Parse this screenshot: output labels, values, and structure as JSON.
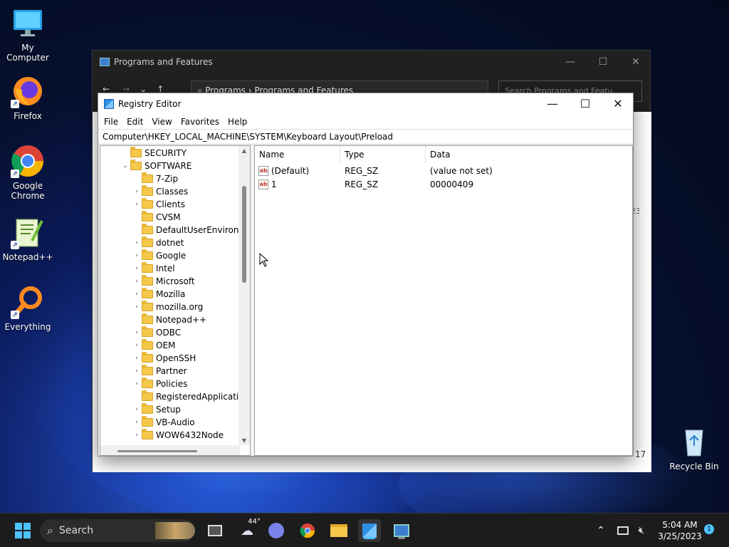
{
  "desktop": {
    "icons": [
      {
        "label": "My Computer",
        "icon": "monitor-icon"
      },
      {
        "label": "Firefox",
        "icon": "firefox-icon"
      },
      {
        "label": "Google Chrome",
        "icon": "chrome-icon"
      },
      {
        "label": "Notepad++",
        "icon": "notepadpp-icon"
      },
      {
        "label": "Everything",
        "icon": "everything-icon"
      },
      {
        "label": "Recycle Bin",
        "icon": "recycle-bin-icon"
      }
    ]
  },
  "programs_window": {
    "title": "Programs and Features",
    "breadcrumb": [
      "Programs",
      "Programs and Features"
    ],
    "search_placeholder": "Search Programs and Featu...",
    "side_marks": "23",
    "bottom_count": "17"
  },
  "registry": {
    "title": "Registry Editor",
    "menu": [
      "File",
      "Edit",
      "View",
      "Favorites",
      "Help"
    ],
    "address": "Computer\\HKEY_LOCAL_MACHINE\\SYSTEM\\Keyboard Layout\\Preload",
    "tree": [
      {
        "label": "SECURITY",
        "level": 1,
        "chevron": ""
      },
      {
        "label": "SOFTWARE",
        "level": 1,
        "chevron": "expanded"
      },
      {
        "label": "7-Zip",
        "level": 2,
        "chevron": ""
      },
      {
        "label": "Classes",
        "level": 2,
        "chevron": "collapsed"
      },
      {
        "label": "Clients",
        "level": 2,
        "chevron": "collapsed"
      },
      {
        "label": "CVSM",
        "level": 2,
        "chevron": ""
      },
      {
        "label": "DefaultUserEnvironm",
        "level": 2,
        "chevron": ""
      },
      {
        "label": "dotnet",
        "level": 2,
        "chevron": "collapsed"
      },
      {
        "label": "Google",
        "level": 2,
        "chevron": "collapsed"
      },
      {
        "label": "Intel",
        "level": 2,
        "chevron": "collapsed"
      },
      {
        "label": "Microsoft",
        "level": 2,
        "chevron": "collapsed"
      },
      {
        "label": "Mozilla",
        "level": 2,
        "chevron": "collapsed"
      },
      {
        "label": "mozilla.org",
        "level": 2,
        "chevron": "collapsed"
      },
      {
        "label": "Notepad++",
        "level": 2,
        "chevron": ""
      },
      {
        "label": "ODBC",
        "level": 2,
        "chevron": "collapsed"
      },
      {
        "label": "OEM",
        "level": 2,
        "chevron": "collapsed"
      },
      {
        "label": "OpenSSH",
        "level": 2,
        "chevron": "collapsed"
      },
      {
        "label": "Partner",
        "level": 2,
        "chevron": "collapsed"
      },
      {
        "label": "Policies",
        "level": 2,
        "chevron": "collapsed"
      },
      {
        "label": "RegisteredApplicatior",
        "level": 2,
        "chevron": ""
      },
      {
        "label": "Setup",
        "level": 2,
        "chevron": "collapsed"
      },
      {
        "label": "VB-Audio",
        "level": 2,
        "chevron": "collapsed"
      },
      {
        "label": "WOW6432Node",
        "level": 2,
        "chevron": "collapsed"
      }
    ],
    "columns": [
      "Name",
      "Type",
      "Data"
    ],
    "values": [
      {
        "name": "(Default)",
        "type": "REG_SZ",
        "data": "(value not set)"
      },
      {
        "name": "1",
        "type": "REG_SZ",
        "data": "00000409"
      }
    ]
  },
  "taskbar": {
    "search_label": "Search",
    "weather_temp": "44°",
    "time": "5:04 AM",
    "date": "3/25/2023",
    "notification_count": "1"
  },
  "colors": {
    "accent": "#4cc2ff",
    "folder": "#f5c84a"
  }
}
